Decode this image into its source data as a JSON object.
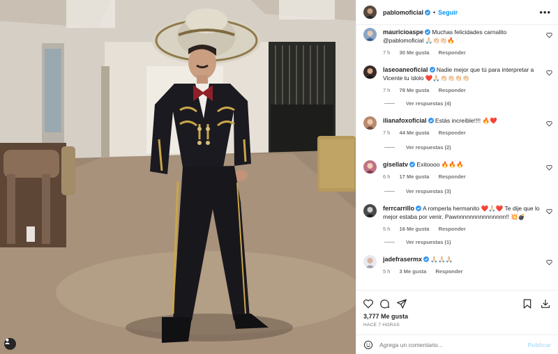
{
  "colors": {
    "link": "#0095f6",
    "text": "#262626",
    "muted": "#737373",
    "heart": "#ed4956",
    "post_disabled": "#b2dffc"
  },
  "post": {
    "author": "pablomoficial",
    "follow_label": "Seguir",
    "dot": "•",
    "more_icon": "more-horizontal-icon",
    "likes": "3,777 Me gusta",
    "date": "HACE 7 HORAS"
  },
  "comments": [
    {
      "user": "mauricioaspe",
      "text": "Muchas felicidades carnalito @pablomoficial 🙏🏻👏🏻👏🏻🔥",
      "time": "7 h",
      "likes": "30 Me gusta",
      "reply": "Responder",
      "replies": ""
    },
    {
      "user": "laseoaneoficial",
      "text": "Nadie mejor que tú para interpretar a Vicente tu ídolo ❤️🙏🏻👏🏻👏🏻👏🏻👏🏻",
      "time": "7 h",
      "likes": "78 Me gusta",
      "reply": "Responder",
      "replies": "Ver respuestas (4)"
    },
    {
      "user": "ilianafoxoficial",
      "text": "Estás increíble!!!! 🔥❤️",
      "time": "7 h",
      "likes": "44 Me gusta",
      "reply": "Responder",
      "replies": "Ver respuestas (2)"
    },
    {
      "user": "gisellatv",
      "text": "Exitoooo 🔥🔥🔥",
      "time": "6 h",
      "likes": "17 Me gusta",
      "reply": "Responder",
      "replies": "Ver respuestas (3)"
    },
    {
      "user": "ferrcarrillo",
      "text": "A romperla hermanito ❤️🙏🏻❤️ Te dije que lo mejor estaba por venir. Pawnnnnnnnnnnnnnnn!! 💥💣",
      "time": "5 h",
      "likes": "16 Me gusta",
      "reply": "Responder",
      "replies": "Ver respuestas (1)"
    },
    {
      "user": "jadefrasermx",
      "text": "🙏🏻🙏🏻🙏🏻",
      "time": "5 h",
      "likes": "3 Me gusta",
      "reply": "Responder",
      "replies": ""
    }
  ],
  "composer": {
    "placeholder": "Agrega un comentario...",
    "post_label": "Publicar"
  }
}
